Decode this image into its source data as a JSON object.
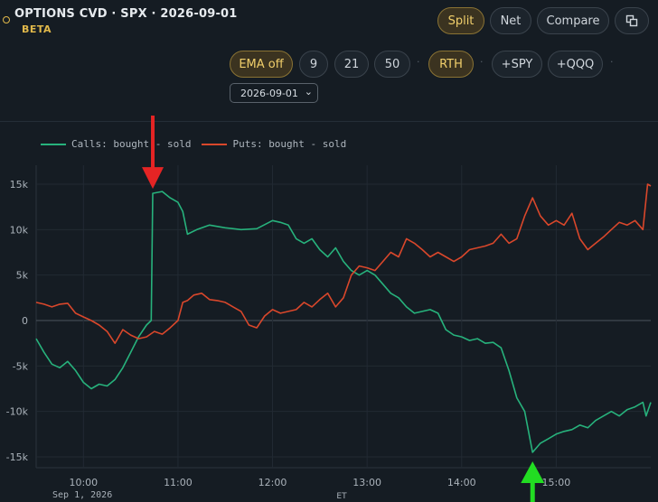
{
  "header": {
    "title": "OPTIONS CVD · SPX · 2026-09-01",
    "badge": "BETA",
    "view_buttons": [
      {
        "label": "Split",
        "active": true
      },
      {
        "label": "Net",
        "active": false
      },
      {
        "label": "Compare",
        "active": false
      }
    ],
    "popout_icon": "popout-icon",
    "controls": [
      {
        "label": "EMA off",
        "active": true
      },
      {
        "label": "9",
        "active": false
      },
      {
        "label": "21",
        "active": false
      },
      {
        "label": "50",
        "active": false
      },
      {
        "label": "RTH",
        "active": true
      },
      {
        "label": "+SPY",
        "active": false
      },
      {
        "label": "+QQQ",
        "active": false
      }
    ],
    "date_value": "2026-09-01",
    "accent_color": "#f1cf6b"
  },
  "chart_data": {
    "type": "line",
    "x_unit": "time (ET)",
    "date_label": "Sep 1, 2026",
    "timezone_label": "ET",
    "x_ticks": [
      "10:00",
      "11:00",
      "12:00",
      "13:00",
      "14:00",
      "15:00"
    ],
    "y_ticks": [
      "15k",
      "10k",
      "5k",
      "0",
      "-5k",
      "-10k",
      "-15k"
    ],
    "ylim": [
      -16000,
      16000
    ],
    "xlim": [
      "09:30",
      "16:00"
    ],
    "grid": true,
    "legend_position": "top-left",
    "series": [
      {
        "name": "Calls: bought - sold",
        "color": "#27b27c",
        "points": [
          [
            "09:30",
            -2000
          ],
          [
            "09:35",
            -3500
          ],
          [
            "09:40",
            -4800
          ],
          [
            "09:45",
            -5200
          ],
          [
            "09:50",
            -4500
          ],
          [
            "09:55",
            -5500
          ],
          [
            "10:00",
            -6800
          ],
          [
            "10:05",
            -7500
          ],
          [
            "10:10",
            -7000
          ],
          [
            "10:15",
            -7200
          ],
          [
            "10:20",
            -6500
          ],
          [
            "10:25",
            -5200
          ],
          [
            "10:30",
            -3500
          ],
          [
            "10:35",
            -1800
          ],
          [
            "10:40",
            -500
          ],
          [
            "10:43",
            0
          ],
          [
            "10:44",
            14000
          ],
          [
            "10:50",
            14200
          ],
          [
            "10:55",
            13500
          ],
          [
            "11:00",
            13000
          ],
          [
            "11:03",
            12000
          ],
          [
            "11:06",
            9500
          ],
          [
            "11:12",
            10000
          ],
          [
            "11:20",
            10500
          ],
          [
            "11:30",
            10200
          ],
          [
            "11:40",
            10000
          ],
          [
            "11:50",
            10100
          ],
          [
            "12:00",
            11000
          ],
          [
            "12:05",
            10800
          ],
          [
            "12:10",
            10500
          ],
          [
            "12:15",
            9000
          ],
          [
            "12:20",
            8500
          ],
          [
            "12:25",
            9000
          ],
          [
            "12:30",
            7800
          ],
          [
            "12:35",
            7000
          ],
          [
            "12:40",
            8000
          ],
          [
            "12:45",
            6500
          ],
          [
            "12:50",
            5500
          ],
          [
            "12:55",
            5000
          ],
          [
            "13:00",
            5500
          ],
          [
            "13:05",
            5000
          ],
          [
            "13:10",
            4000
          ],
          [
            "13:15",
            3000
          ],
          [
            "13:20",
            2500
          ],
          [
            "13:25",
            1500
          ],
          [
            "13:30",
            800
          ],
          [
            "13:35",
            1000
          ],
          [
            "13:40",
            1200
          ],
          [
            "13:45",
            800
          ],
          [
            "13:50",
            -1000
          ],
          [
            "13:55",
            -1600
          ],
          [
            "14:00",
            -1800
          ],
          [
            "14:05",
            -2200
          ],
          [
            "14:10",
            -2000
          ],
          [
            "14:15",
            -2500
          ],
          [
            "14:20",
            -2400
          ],
          [
            "14:25",
            -3000
          ],
          [
            "14:30",
            -5500
          ],
          [
            "14:35",
            -8500
          ],
          [
            "14:40",
            -10000
          ],
          [
            "14:45",
            -14500
          ],
          [
            "14:50",
            -13500
          ],
          [
            "14:55",
            -13000
          ],
          [
            "15:00",
            -12500
          ],
          [
            "15:05",
            -12200
          ],
          [
            "15:10",
            -12000
          ],
          [
            "15:15",
            -11500
          ],
          [
            "15:20",
            -11800
          ],
          [
            "15:25",
            -11000
          ],
          [
            "15:30",
            -10500
          ],
          [
            "15:35",
            -10000
          ],
          [
            "15:40",
            -10500
          ],
          [
            "15:45",
            -9800
          ],
          [
            "15:50",
            -9500
          ],
          [
            "15:55",
            -9000
          ],
          [
            "15:57",
            -10500
          ],
          [
            "16:00",
            -9000
          ]
        ]
      },
      {
        "name": "Puts: bought - sold",
        "color": "#d9472b",
        "points": [
          [
            "09:30",
            2000
          ],
          [
            "09:35",
            1800
          ],
          [
            "09:40",
            1500
          ],
          [
            "09:45",
            1800
          ],
          [
            "09:50",
            1900
          ],
          [
            "09:55",
            800
          ],
          [
            "10:00",
            400
          ],
          [
            "10:05",
            0
          ],
          [
            "10:10",
            -500
          ],
          [
            "10:15",
            -1200
          ],
          [
            "10:20",
            -2500
          ],
          [
            "10:25",
            -1000
          ],
          [
            "10:30",
            -1600
          ],
          [
            "10:35",
            -2000
          ],
          [
            "10:40",
            -1800
          ],
          [
            "10:45",
            -1200
          ],
          [
            "10:50",
            -1500
          ],
          [
            "10:55",
            -800
          ],
          [
            "11:00",
            0
          ],
          [
            "11:03",
            2000
          ],
          [
            "11:06",
            2200
          ],
          [
            "11:10",
            2800
          ],
          [
            "11:15",
            3000
          ],
          [
            "11:20",
            2300
          ],
          [
            "11:25",
            2200
          ],
          [
            "11:30",
            2000
          ],
          [
            "11:35",
            1500
          ],
          [
            "11:40",
            1000
          ],
          [
            "11:45",
            -500
          ],
          [
            "11:50",
            -800
          ],
          [
            "11:55",
            500
          ],
          [
            "12:00",
            1200
          ],
          [
            "12:05",
            800
          ],
          [
            "12:10",
            1000
          ],
          [
            "12:15",
            1200
          ],
          [
            "12:20",
            2000
          ],
          [
            "12:25",
            1500
          ],
          [
            "12:30",
            2300
          ],
          [
            "12:35",
            3000
          ],
          [
            "12:40",
            1500
          ],
          [
            "12:45",
            2500
          ],
          [
            "12:50",
            5000
          ],
          [
            "12:55",
            6000
          ],
          [
            "13:00",
            5800
          ],
          [
            "13:05",
            5500
          ],
          [
            "13:10",
            6500
          ],
          [
            "13:15",
            7500
          ],
          [
            "13:20",
            7000
          ],
          [
            "13:25",
            9000
          ],
          [
            "13:30",
            8500
          ],
          [
            "13:35",
            7800
          ],
          [
            "13:40",
            7000
          ],
          [
            "13:45",
            7500
          ],
          [
            "13:50",
            7000
          ],
          [
            "13:55",
            6500
          ],
          [
            "14:00",
            7000
          ],
          [
            "14:05",
            7800
          ],
          [
            "14:10",
            8000
          ],
          [
            "14:15",
            8200
          ],
          [
            "14:20",
            8500
          ],
          [
            "14:25",
            9500
          ],
          [
            "14:30",
            8500
          ],
          [
            "14:35",
            9000
          ],
          [
            "14:40",
            11500
          ],
          [
            "14:45",
            13500
          ],
          [
            "14:50",
            11500
          ],
          [
            "14:55",
            10500
          ],
          [
            "15:00",
            11000
          ],
          [
            "15:05",
            10500
          ],
          [
            "15:10",
            11800
          ],
          [
            "15:15",
            9000
          ],
          [
            "15:20",
            7800
          ],
          [
            "15:25",
            8500
          ],
          [
            "15:30",
            9200
          ],
          [
            "15:35",
            10000
          ],
          [
            "15:40",
            10800
          ],
          [
            "15:45",
            10500
          ],
          [
            "15:50",
            11000
          ],
          [
            "15:55",
            10000
          ],
          [
            "15:58",
            15000
          ],
          [
            "16:00",
            14800
          ]
        ]
      }
    ],
    "annotations": [
      {
        "type": "arrow",
        "color": "#e52424",
        "direction": "down",
        "target_time": "10:44",
        "target_value": 14000
      },
      {
        "type": "arrow",
        "color": "#22dd22",
        "direction": "up",
        "target_time": "14:45",
        "target_value": -14500
      }
    ]
  }
}
